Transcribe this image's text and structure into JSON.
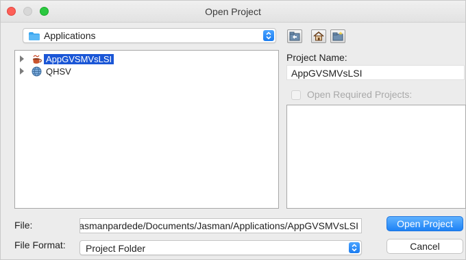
{
  "window": {
    "title": "Open Project"
  },
  "folder_combo": {
    "selected": "Applications"
  },
  "toolbar": {
    "buttons": [
      {
        "icon": "folder-up-icon"
      },
      {
        "icon": "home-icon"
      },
      {
        "icon": "new-folder-icon"
      }
    ]
  },
  "tree": {
    "items": [
      {
        "label": "AppGVSMVsLSI",
        "icon": "coffee-cup-icon",
        "selected": true
      },
      {
        "label": "QHSV",
        "icon": "globe-icon",
        "selected": false
      }
    ]
  },
  "project": {
    "name_label": "Project Name:",
    "name_value": "AppGVSMVsLSI",
    "open_required_label": "Open Required Projects:"
  },
  "file": {
    "label": "File:",
    "value": "jasmanpardede/Documents/Jasman/Applications/AppGVSMVsLSI"
  },
  "format": {
    "label": "File Format:",
    "selected": "Project Folder"
  },
  "buttons": {
    "open": "Open Project",
    "cancel": "Cancel"
  },
  "colors": {
    "accent": "#1e82f5",
    "selection": "#1a56d6",
    "close": "#fd5f57",
    "maximize": "#2bc840"
  }
}
